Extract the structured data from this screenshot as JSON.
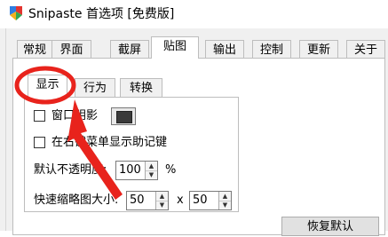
{
  "window": {
    "title": "Snipaste 首选项 [免费版]"
  },
  "main_tabs": [
    {
      "label": "常规"
    },
    {
      "label": "界面"
    },
    {
      "label": "截屏"
    },
    {
      "label": "贴图"
    },
    {
      "label": "输出"
    },
    {
      "label": "控制"
    },
    {
      "label": "更新"
    },
    {
      "label": "关于"
    }
  ],
  "main_tabs_active": "贴图",
  "sub_tabs": [
    {
      "label": "显示"
    },
    {
      "label": "行为"
    },
    {
      "label": "转换"
    }
  ],
  "sub_tabs_active": "显示",
  "display": {
    "window_shadow_label": "窗口阴影",
    "show_key_label": "在右键菜单显示助记键",
    "opacity_label": "默认不透明度:",
    "opacity_value": "100",
    "opacity_unit": "%",
    "thumb_label": "快速缩略图大小:",
    "thumb_width": "50",
    "thumb_sep": "x",
    "thumb_height": "50",
    "reset_label": "恢复默认"
  },
  "colors": {
    "annotation_red": "#e8231c",
    "shadow_swatch": "#3a3a3a"
  }
}
